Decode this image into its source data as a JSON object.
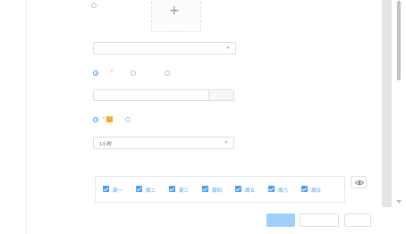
{
  "sidebar": {
    "label": ""
  },
  "form": {
    "cover": {
      "label": "",
      "radio_label": ""
    },
    "category": {
      "label": "",
      "value": "",
      "manage_link": ""
    },
    "range": {
      "label": "",
      "options": [
        {
          "label": ""
        },
        {
          "label": ""
        },
        {
          "label": ""
        }
      ],
      "search_placeholder": "",
      "search_button": ""
    },
    "sync": {
      "label": "",
      "options": [
        {
          "label": ""
        },
        {
          "label": ""
        }
      ]
    },
    "duration": {
      "label": "",
      "value": "1小时"
    },
    "schedule": {
      "label": "",
      "hint": "",
      "hint_link": "",
      "days": [
        {
          "label": "周一"
        },
        {
          "label": "周二"
        },
        {
          "label": "周三"
        },
        {
          "label": "周四"
        },
        {
          "label": "周五"
        },
        {
          "label": "周六"
        },
        {
          "label": "周日"
        }
      ]
    }
  },
  "actions": {
    "save": "",
    "save_and_publish": "",
    "cancel": ""
  },
  "colors": {
    "accent": "#409eff",
    "accent_disabled": "#a0cfff",
    "required": "#f56c6c",
    "badge": "#f5a623"
  }
}
